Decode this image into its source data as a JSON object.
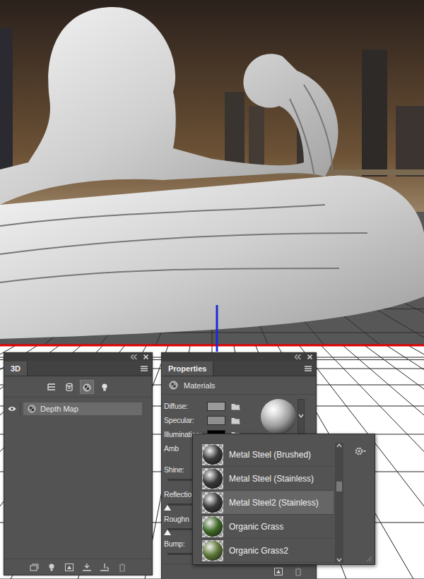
{
  "panel_3d": {
    "tab": "3D",
    "filters": [
      {
        "selected": false
      },
      {
        "selected": false
      },
      {
        "selected": true
      },
      {
        "selected": false
      }
    ],
    "layers": [
      {
        "label": "Depth Map",
        "visible": true,
        "selected": true
      }
    ]
  },
  "properties": {
    "tab": "Properties",
    "section": "Materials",
    "fields": [
      {
        "label": "Diffuse:",
        "color": "#9a9a9a"
      },
      {
        "label": "Specular:",
        "color": "#8e8e8e"
      },
      {
        "label": "Illumination:",
        "color": "#000000"
      },
      {
        "label": "Amb"
      }
    ],
    "sliders": [
      {
        "label": "Shine:"
      },
      {
        "label": "Reflectio",
        "level": 0
      },
      {
        "label": "Roughn",
        "level": 0
      },
      {
        "label": "Bump:"
      }
    ]
  },
  "material_picker": {
    "items": [
      {
        "label": "Metal Steel (Brushed)",
        "selected": false,
        "color": "#3a3a3a"
      },
      {
        "label": "Metal Steel (Stainless)",
        "selected": false,
        "color": "#3a3a3a"
      },
      {
        "label": "Metal Steel2 (Stainless)",
        "selected": true,
        "color": "#3a3a3a"
      },
      {
        "label": "Organic Grass",
        "selected": false,
        "color": "#3f6a28"
      },
      {
        "label": "Organic Grass2",
        "selected": false,
        "color": "#5f7a38"
      }
    ],
    "scroll_level": 0.33
  }
}
